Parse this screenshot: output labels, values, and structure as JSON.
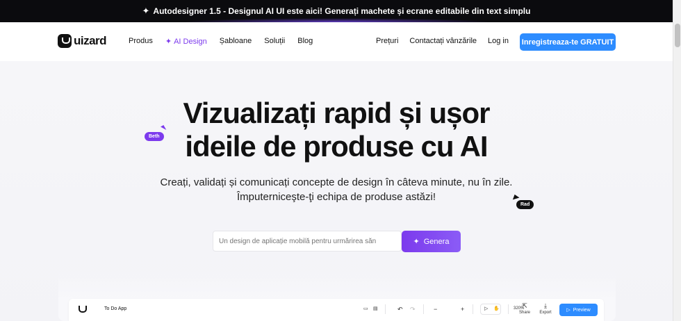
{
  "banner": {
    "icon": "sparkle-icon",
    "text": "Autodesigner 1.5 - Designul AI UI este aici! Generați machete și ecrane editabile din text simplu"
  },
  "nav": {
    "logo": "uizard",
    "links": [
      "Produs",
      "AI Design",
      "Șabloane",
      "Soluții",
      "Blog"
    ],
    "right": [
      "Prețuri",
      "Contactați vânzările",
      "Log in"
    ],
    "cta": "Inregistreaza-te GRATUIT"
  },
  "hero": {
    "title_line1": "Vizualizați rapid și ușor",
    "title_line2": "ideile de produse cu AI",
    "sub_line1": "Creați, validați și comunicați concepte de design în câteva minute, nu în zile.",
    "sub_line2": "Împuterniceşte-ţi echipa de produse astăzi!",
    "cursor_beth": "Beth",
    "cursor_rad": "Rad",
    "prompt_placeholder": "Un design de aplicație mobilă pentru urmărirea săn",
    "generate_button": "Genera"
  },
  "editor": {
    "project_name": "To Do App",
    "zoom": "320%",
    "share": "Share",
    "export": "Export",
    "preview": "Preview"
  },
  "colors": {
    "accent_purple": "#7c3aed",
    "accent_blue": "#2d8cff",
    "banner_bg": "#0b0b0e"
  }
}
